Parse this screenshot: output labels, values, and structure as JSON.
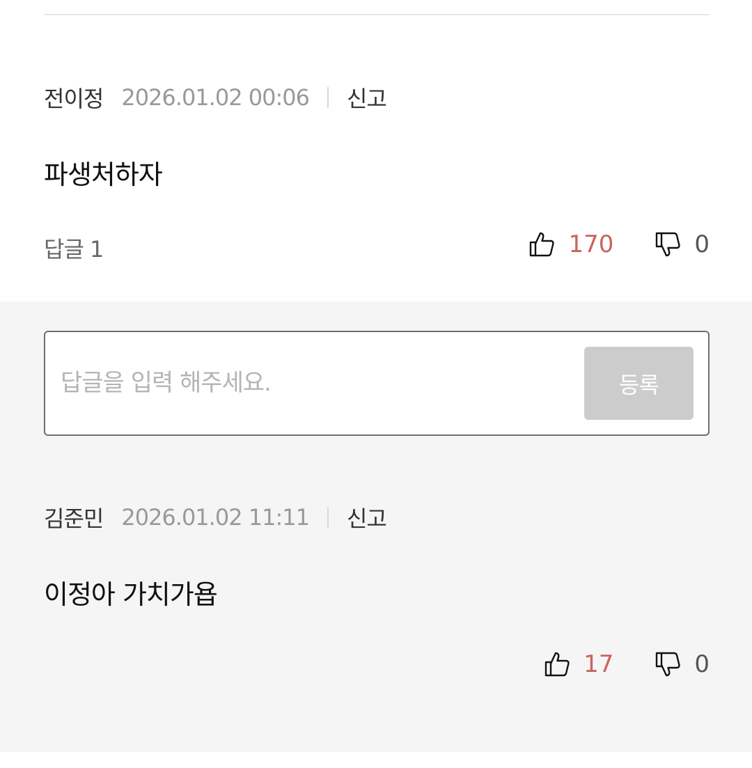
{
  "comments": [
    {
      "author": "전이정",
      "timestamp": "2026.01.02 00:06",
      "report_label": "신고",
      "text": "파생처하자",
      "reply_label": "답글 1",
      "likes": "170",
      "dislikes": "0"
    },
    {
      "author": "김준민",
      "timestamp": "2026.01.02 11:11",
      "report_label": "신고",
      "text": "이정아 가치가욥",
      "likes": "17",
      "dislikes": "0"
    }
  ],
  "reply_form": {
    "placeholder": "답글을 입력 해주세요.",
    "value": "",
    "submit_label": "등록"
  },
  "colors": {
    "like_count": "#c9635b",
    "reply_area_bg": "#f5f5f5",
    "submit_button_bg": "#cccccc"
  },
  "icons": {
    "like": "thumbs-up-icon",
    "dislike": "thumbs-down-icon"
  }
}
